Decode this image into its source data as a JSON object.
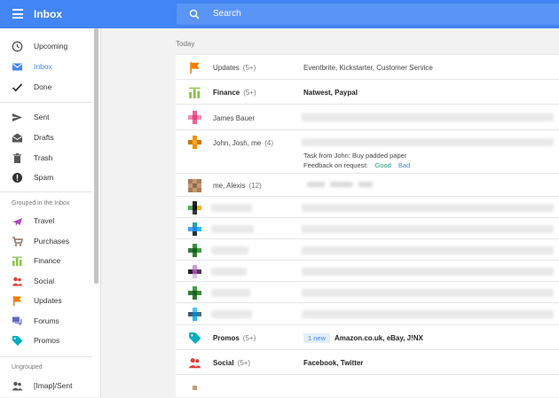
{
  "app": {
    "title": "Inbox"
  },
  "search": {
    "placeholder": "Search"
  },
  "sidebar": {
    "items": [
      {
        "label": "Upcoming",
        "icon": "clock-icon"
      },
      {
        "label": "Inbox",
        "icon": "inbox-icon",
        "active": true
      },
      {
        "label": "Done",
        "icon": "check-icon"
      },
      {
        "label": "Sent",
        "icon": "send-icon"
      },
      {
        "label": "Drafts",
        "icon": "drafts-icon"
      },
      {
        "label": "Trash",
        "icon": "trash-icon"
      },
      {
        "label": "Spam",
        "icon": "spam-icon"
      }
    ],
    "group_header": "Grouped in the Inbox",
    "groups": [
      {
        "label": "Travel",
        "icon": "plane-icon"
      },
      {
        "label": "Purchases",
        "icon": "cart-icon"
      },
      {
        "label": "Finance",
        "icon": "finance-icon"
      },
      {
        "label": "Social",
        "icon": "people-icon"
      },
      {
        "label": "Updates",
        "icon": "flag-icon"
      },
      {
        "label": "Forums",
        "icon": "forum-icon"
      },
      {
        "label": "Promos",
        "icon": "tag-icon"
      }
    ],
    "ungrouped_header": "Ungrouped",
    "ungrouped": [
      {
        "label": "[Imap]/Sent",
        "icon": "people-icon"
      }
    ]
  },
  "main": {
    "section": "Today",
    "rows": {
      "updates": {
        "sender": "Updates",
        "count": "(5+)",
        "summary": "Eventbrite, Kickstarter, Customer Service"
      },
      "finance": {
        "sender": "Finance",
        "count": "(5+)",
        "summary": "Natwest, Paypal"
      },
      "james": {
        "sender": "James Bauer"
      },
      "john": {
        "sender": "John, Josh, me",
        "count": "(4)",
        "task": "Task from John: Buy padded paper",
        "feedback": "Feedback on request:",
        "good": "Good",
        "bad": "Bad"
      },
      "alexis": {
        "sender": "me, Alexis",
        "count": "(12)"
      },
      "promos": {
        "sender": "Promos",
        "count": "(5+)",
        "badge": "1 new",
        "summary": "Amazon.co.uk, eBay, J!NX"
      },
      "social": {
        "sender": "Social",
        "count": "(5+)",
        "summary": "Facebook, Twitter"
      }
    }
  },
  "colors": {
    "accent": "#4285f4",
    "updates": "#f57c00",
    "finance": "#8bc34a",
    "social": "#e53935",
    "promos": "#00acc1",
    "travel": "#ab47bc",
    "purchases": "#8d6e63",
    "forums": "#5c6bc0"
  }
}
